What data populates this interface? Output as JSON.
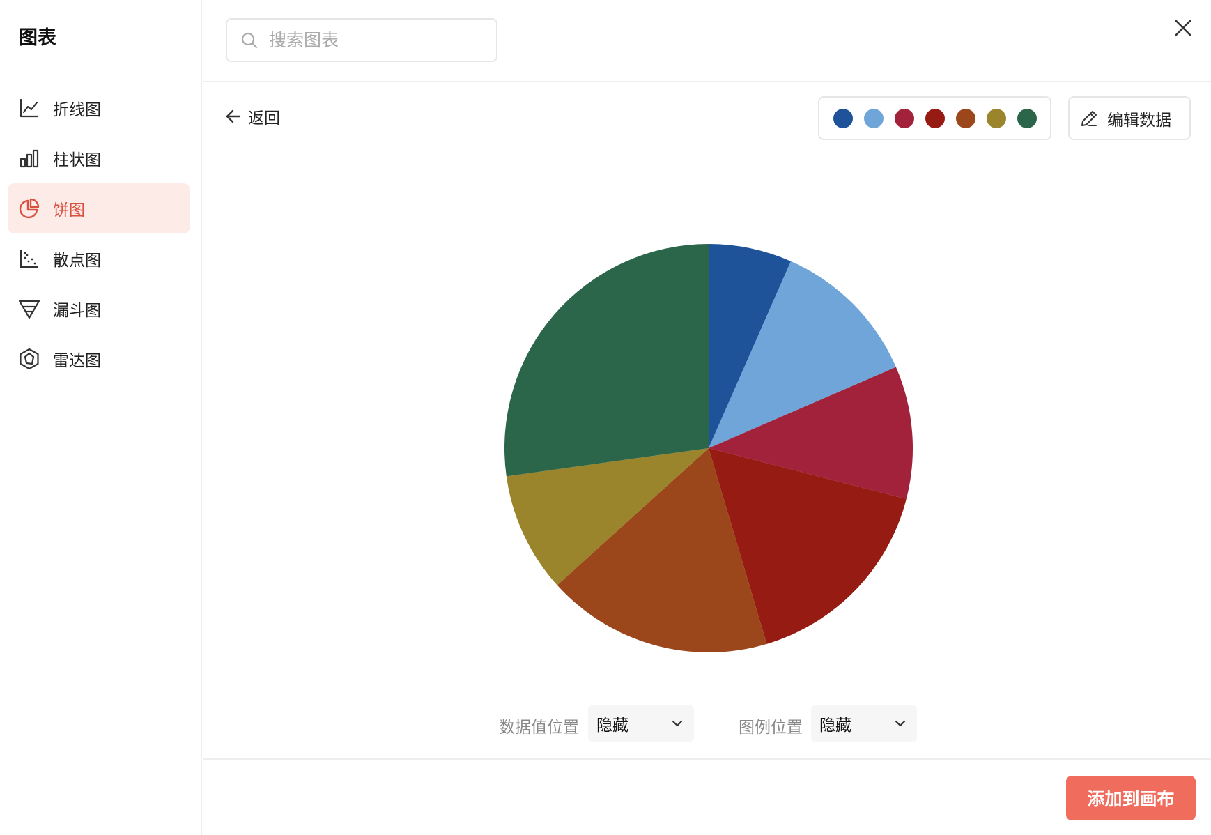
{
  "sidebar": {
    "title": "图表",
    "items": [
      {
        "label": "折线图",
        "icon": "line-chart-icon",
        "active": false
      },
      {
        "label": "柱状图",
        "icon": "bar-chart-icon",
        "active": false
      },
      {
        "label": "饼图",
        "icon": "pie-chart-icon",
        "active": true
      },
      {
        "label": "散点图",
        "icon": "scatter-chart-icon",
        "active": false
      },
      {
        "label": "漏斗图",
        "icon": "funnel-chart-icon",
        "active": false
      },
      {
        "label": "雷达图",
        "icon": "radar-chart-icon",
        "active": false
      }
    ]
  },
  "search": {
    "placeholder": "搜索图表",
    "value": ""
  },
  "toolbar": {
    "back_label": "返回",
    "edit_label": "编辑数据",
    "palette": [
      "#1f5399",
      "#6fa5d8",
      "#a3223b",
      "#961b12",
      "#9c471b",
      "#9a842c",
      "#2c664a"
    ]
  },
  "controls": {
    "data_label_position": {
      "label": "数据值位置",
      "value": "隐藏"
    },
    "legend_position": {
      "label": "图例位置",
      "value": "隐藏"
    }
  },
  "footer": {
    "add_label": "添加到画布"
  },
  "colors": {
    "accent": "#f06d5e",
    "active_bg": "#fdebe8",
    "active_text": "#d9503f"
  },
  "chart_data": {
    "type": "pie",
    "title": "",
    "legend": "hidden",
    "data_labels": "hidden",
    "slices": [
      {
        "value": 6.6,
        "color": "#1f5399"
      },
      {
        "value": 11.9,
        "color": "#6fa5d8"
      },
      {
        "value": 10.5,
        "color": "#a3223b"
      },
      {
        "value": 16.4,
        "color": "#961b12"
      },
      {
        "value": 17.9,
        "color": "#9c471b"
      },
      {
        "value": 9.5,
        "color": "#9a842c"
      },
      {
        "value": 27.2,
        "color": "#2c664a"
      }
    ]
  }
}
